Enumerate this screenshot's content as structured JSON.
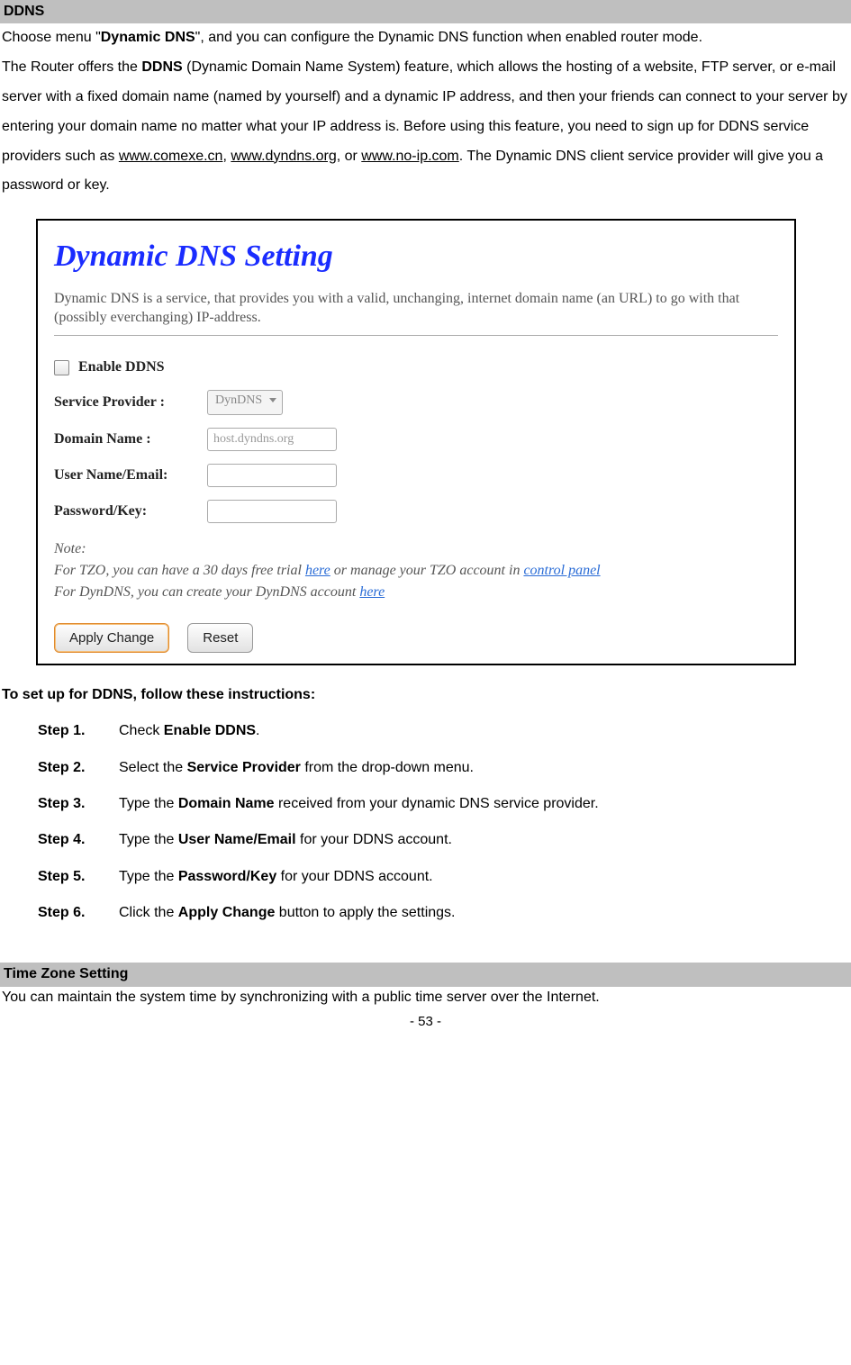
{
  "headers": {
    "ddns": "DDNS",
    "timezone": "Time Zone Setting"
  },
  "intro": {
    "p1a": "Choose menu \"",
    "p1b": "Dynamic DNS",
    "p1c": "\", and you can configure the Dynamic DNS function when enabled router mode.",
    "p2a": "The Router offers the ",
    "p2b": "DDNS",
    "p2c": " (Dynamic Domain Name System) feature, which allows the hosting of a website, FTP server, or e-mail server with a fixed domain name (named by yourself) and a dynamic IP address, and then your friends can connect to your server by entering your domain name no matter what your IP address is. Before using this feature, you need to sign up for DDNS service providers such as ",
    "link1": "www.comexe.cn",
    "sep1": ", ",
    "link2": "www.dyndns.org",
    "sep2": ", or ",
    "link3": "www.no-ip.com",
    "p2d": ". The Dynamic DNS client service provider will give you a password or key."
  },
  "shot": {
    "title": "Dynamic DNS  Setting",
    "desc": "Dynamic DNS is a service, that provides you with a valid, unchanging, internet domain name (an URL) to go with that (possibly everchanging) IP-address.",
    "enable": "Enable DDNS",
    "sp_label": "Service Provider :",
    "sp_value": "DynDNS",
    "dn_label": "Domain Name :",
    "dn_value": "host.dyndns.org",
    "un_label": "User Name/Email:",
    "pw_label": "Password/Key:",
    "note": "Note:",
    "note1a": "For TZO, you can have a 30 days free trial ",
    "note1_here": "here",
    "note1b": " or manage your TZO account in ",
    "note1_cp": "control panel",
    "note2a": "For DynDNS, you can create your DynDNS account ",
    "note2_here": "here",
    "btn_apply": "Apply Change",
    "btn_reset": "Reset"
  },
  "instr": {
    "heading": "To set up for DDNS, follow these instructions:",
    "steps": [
      {
        "label": "Step 1.",
        "pre": "Check ",
        "bold": "Enable DDNS",
        "post": "."
      },
      {
        "label": "Step 2.",
        "pre": "Select the ",
        "bold": "Service Provider",
        "post": " from the drop-down menu."
      },
      {
        "label": "Step 3.",
        "pre": "Type the ",
        "bold": "Domain Name",
        "post": " received from your dynamic DNS service provider."
      },
      {
        "label": "Step 4.",
        "pre": "Type the ",
        "bold": "User Name/Email",
        "post": " for your DDNS account."
      },
      {
        "label": "Step 5.",
        "pre": "Type the ",
        "bold": "Password/Key",
        "post": " for your DDNS account."
      },
      {
        "label": "Step 6.",
        "pre": "Click the ",
        "bold": "Apply Change",
        "post": " button to apply the settings."
      }
    ]
  },
  "timezone": {
    "text": "You can maintain the system time by synchronizing with a public time server over the Internet."
  },
  "page": "- 53 -"
}
